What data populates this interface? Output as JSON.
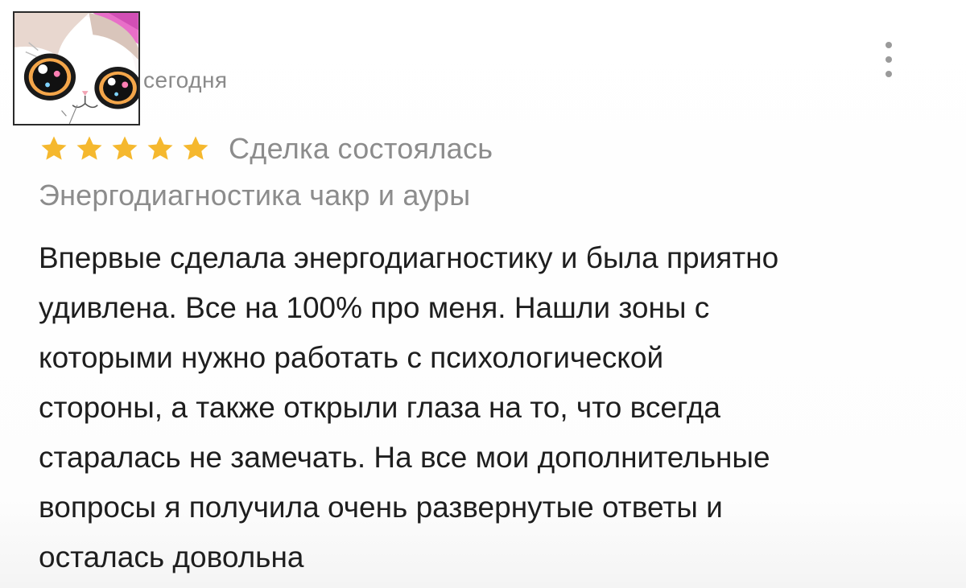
{
  "review": {
    "date": "сегодня",
    "rating": 5,
    "deal_status": "Сделка состоялась",
    "service_name": "Энергодиагностика чакр и ауры",
    "text": "Впервые сделала энергодиагностику и была приятно\nудивлена. Все на 100% про меня. Нашли зоны с\nкоторыми нужно работать с психологической\nстороны, а также открыли глаза на то, что всегда\nстаралась не замечать. На все мои дополнительные\nвопросы я получила очень развернутые ответы и\nосталась довольна"
  },
  "icons": {
    "avatar": "cat-avatar-image",
    "menu": "more-vertical-icon",
    "star": "star-icon"
  },
  "colors": {
    "star": "#f5b82e",
    "secondary_text": "#8c8c8c",
    "primary_text": "#1e1e1e",
    "menu_dots": "#9a9a9a"
  }
}
